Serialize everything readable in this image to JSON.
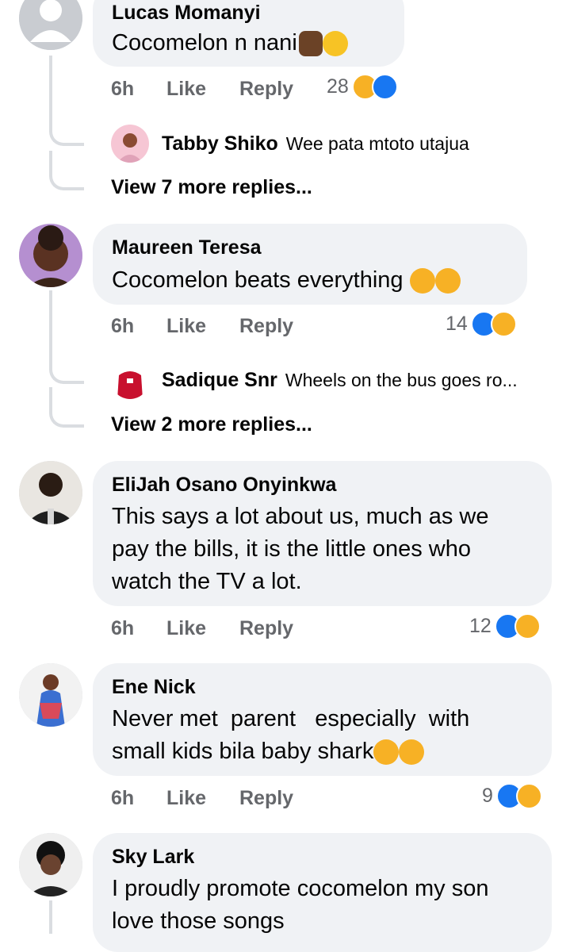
{
  "comments": [
    {
      "author": "Lucas Momanyi",
      "text": "Cocomelon n nani",
      "time": "6h",
      "like_label": "Like",
      "reply_label": "Reply",
      "reaction_count": "28",
      "reply_preview": {
        "author": "Tabby Shiko",
        "text": "Wee pata mtoto utajua"
      },
      "more_replies": "View 7 more replies..."
    },
    {
      "author": "Maureen Teresa",
      "text": "Cocomelon beats everything",
      "time": "6h",
      "like_label": "Like",
      "reply_label": "Reply",
      "reaction_count": "14",
      "reply_preview": {
        "author": "Sadique Snr",
        "text": "Wheels on the bus goes ro..."
      },
      "more_replies": "View 2 more replies..."
    },
    {
      "author": "EliJah Osano Onyinkwa",
      "text_lines": [
        "This says a lot about us, much as we",
        "pay the bills, it is the little ones who",
        "watch the TV a lot."
      ],
      "time": "6h",
      "like_label": "Like",
      "reply_label": "Reply",
      "reaction_count": "12"
    },
    {
      "author": "Ene Nick",
      "text_lines": [
        "Never met  parent   especially  with",
        "small kids bila baby shark"
      ],
      "time": "6h",
      "like_label": "Like",
      "reply_label": "Reply",
      "reaction_count": "9"
    },
    {
      "author": "Sky Lark",
      "text_lines": [
        "I proudly promote cocomelon my son",
        "love those songs"
      ]
    }
  ],
  "colors": {
    "bubble": "#f0f2f5",
    "meta": "#65676b",
    "like": "#1877f2",
    "haha": "#f7b125",
    "thread": "#dadde1"
  }
}
